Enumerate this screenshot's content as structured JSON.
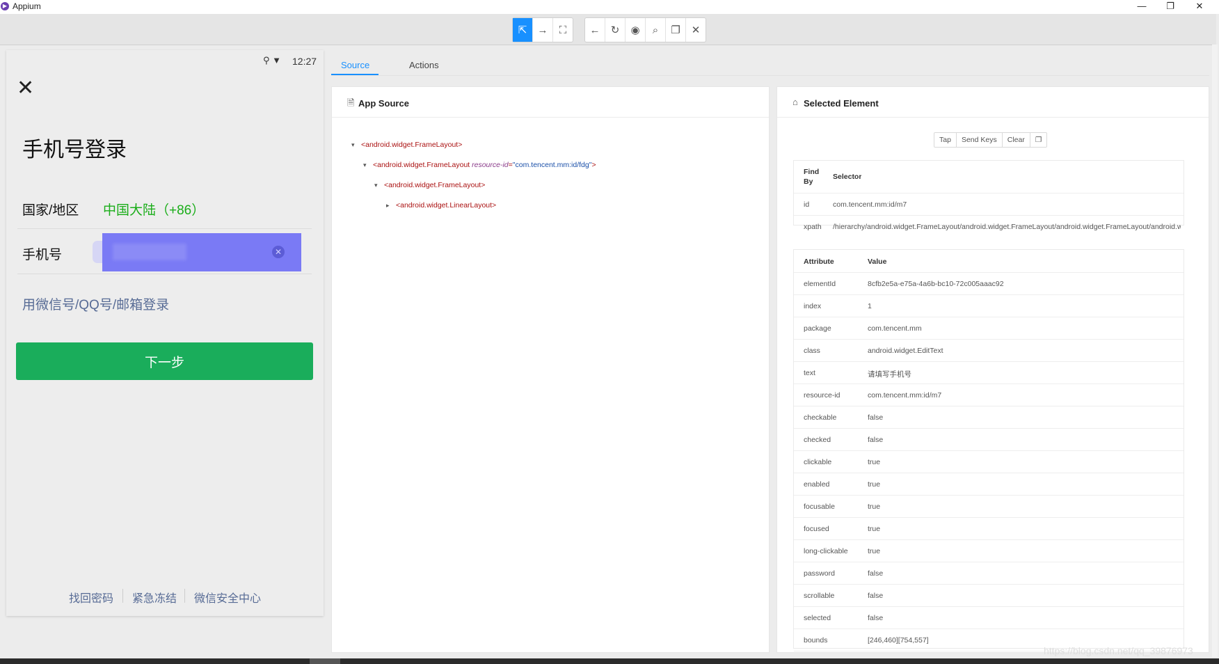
{
  "window": {
    "title": "Appium",
    "minimize": "—",
    "maximize": "❐",
    "close": "✕"
  },
  "toolbar": {
    "group1": [
      "select-icon",
      "swipe-icon",
      "tap-coordinates-icon"
    ],
    "group1_glyphs": [
      "⇱",
      "→",
      "⛶"
    ],
    "group2": [
      "back-icon",
      "refresh-icon",
      "eye-icon",
      "search-icon",
      "copy-icon",
      "quit-icon"
    ],
    "group2_glyphs": [
      "←",
      "↻",
      "◉",
      "⌕",
      "❐",
      "✕"
    ]
  },
  "device": {
    "time": "12:27",
    "status_icons": "⚲ ▼",
    "close_glyph": "✕",
    "title": "手机号登录",
    "country_label": "国家/地区",
    "country_value": "中国大陆（+86）",
    "phone_label": "手机号",
    "clear_glyph": "✕",
    "alt_login": "用微信号/QQ号/邮箱登录",
    "next_button": "下一步",
    "footer_links": [
      "找回密码",
      "紧急冻结",
      "微信安全中心"
    ]
  },
  "tabs": {
    "source": "Source",
    "actions": "Actions"
  },
  "source_panel": {
    "title": "App Source",
    "icon": "document-icon",
    "tree": [
      {
        "arrow": "▾",
        "tag": "<android.widget.FrameLayout>"
      },
      {
        "arrow": "▾",
        "tag_open": "<android.widget.FrameLayout ",
        "attr": "resource-id",
        "eq": "=",
        "value": "\"com.tencent.mm:id/fdg\"",
        "tag_close": ">"
      },
      {
        "arrow": "▾",
        "tag": "<android.widget.FrameLayout>"
      },
      {
        "arrow": "▸",
        "tag": "<android.widget.LinearLayout>"
      }
    ]
  },
  "selected_panel": {
    "title": "Selected Element",
    "icon": "tag-icon",
    "actions": [
      "Tap",
      "Send Keys",
      "Clear"
    ],
    "copy_glyph": "❐",
    "selector_header": {
      "find_by": "Find By",
      "selector": "Selector"
    },
    "selectors": [
      {
        "by": "id",
        "value": "com.tencent.mm:id/m7"
      },
      {
        "by": "xpath",
        "value": "/hierarchy/android.widget.FrameLayout/android.widget.FrameLayout/android.widget.FrameLayout/android.w"
      }
    ],
    "attr_header": {
      "attribute": "Attribute",
      "value": "Value"
    },
    "attributes": [
      {
        "name": "elementId",
        "value": "8cfb2e5a-e75a-4a6b-bc10-72c005aaac92"
      },
      {
        "name": "index",
        "value": "1"
      },
      {
        "name": "package",
        "value": "com.tencent.mm"
      },
      {
        "name": "class",
        "value": "android.widget.EditText"
      },
      {
        "name": "text",
        "value": "请填写手机号"
      },
      {
        "name": "resource-id",
        "value": "com.tencent.mm:id/m7"
      },
      {
        "name": "checkable",
        "value": "false"
      },
      {
        "name": "checked",
        "value": "false"
      },
      {
        "name": "clickable",
        "value": "true"
      },
      {
        "name": "enabled",
        "value": "true"
      },
      {
        "name": "focusable",
        "value": "true"
      },
      {
        "name": "focused",
        "value": "true"
      },
      {
        "name": "long-clickable",
        "value": "true"
      },
      {
        "name": "password",
        "value": "false"
      },
      {
        "name": "scrollable",
        "value": "false"
      },
      {
        "name": "selected",
        "value": "false"
      },
      {
        "name": "bounds",
        "value": "[246,460][754,557]"
      }
    ]
  },
  "watermark": "https://blog.csdn.net/qq_39876973"
}
